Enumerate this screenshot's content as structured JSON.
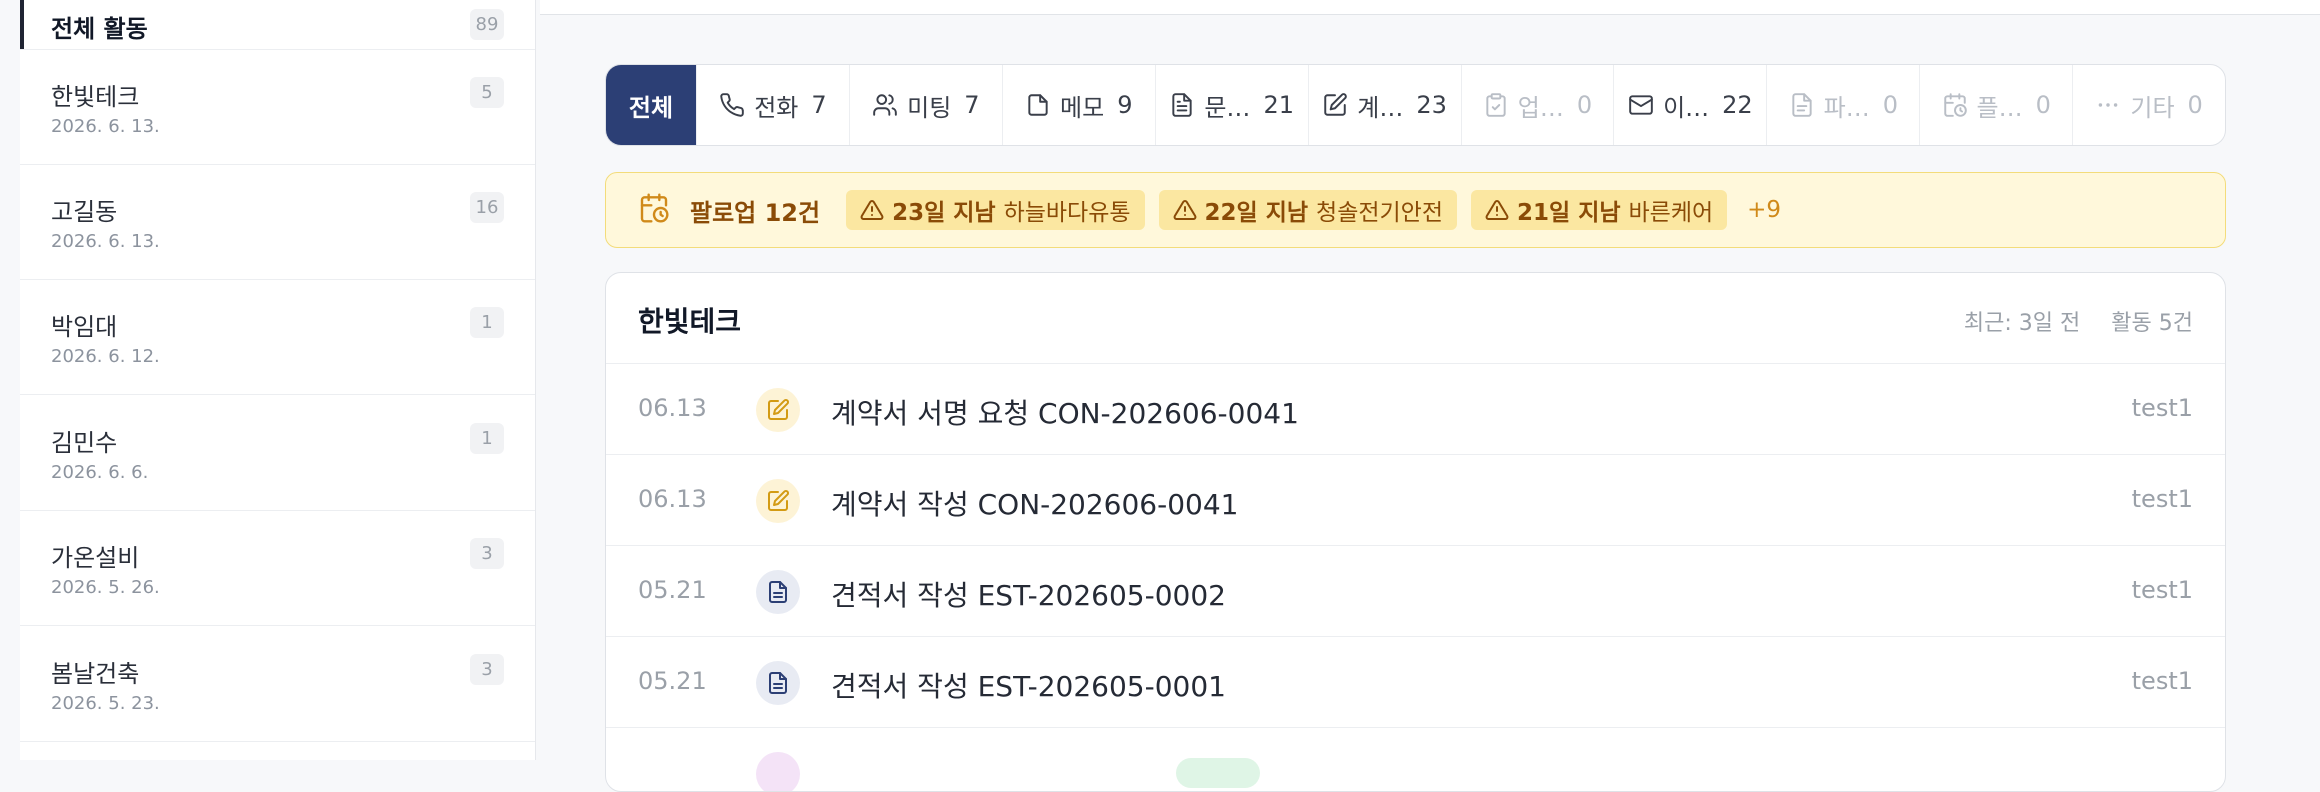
{
  "sidebar": {
    "all": {
      "label": "전체 활동",
      "count": "89"
    },
    "items": [
      {
        "name": "한빛테크",
        "date": "2026. 6. 13.",
        "count": "5"
      },
      {
        "name": "고길동",
        "date": "2026. 6. 13.",
        "count": "16"
      },
      {
        "name": "박임대",
        "date": "2026. 6. 12.",
        "count": "1"
      },
      {
        "name": "김민수",
        "date": "2026. 6. 6.",
        "count": "1"
      },
      {
        "name": "가온설비",
        "date": "2026. 5. 26.",
        "count": "3"
      },
      {
        "name": "봄날건축",
        "date": "2026. 5. 23.",
        "count": "3"
      }
    ]
  },
  "tabs": [
    {
      "label": "전체",
      "count": "",
      "icon": "none"
    },
    {
      "label": "전화",
      "count": "7",
      "icon": "phone-icon"
    },
    {
      "label": "미팅",
      "count": "7",
      "icon": "users-icon"
    },
    {
      "label": "메모",
      "count": "9",
      "icon": "note-icon"
    },
    {
      "label": "문…",
      "count": "21",
      "icon": "document-icon"
    },
    {
      "label": "계…",
      "count": "23",
      "icon": "contract-icon"
    },
    {
      "label": "업…",
      "count": "0",
      "icon": "clipboard-icon"
    },
    {
      "label": "이…",
      "count": "22",
      "icon": "mail-icon"
    },
    {
      "label": "파…",
      "count": "0",
      "icon": "file-icon"
    },
    {
      "label": "플…",
      "count": "0",
      "icon": "calendar-clock-icon"
    },
    {
      "label": "기타",
      "count": "0",
      "icon": "more-icon"
    }
  ],
  "followup": {
    "title": "팔로업 12건",
    "chips": [
      {
        "days": "23일 지남",
        "company": "하늘바다유통"
      },
      {
        "days": "22일 지남",
        "company": "청솔전기안전"
      },
      {
        "days": "21일 지남",
        "company": "바른케어"
      }
    ],
    "more": "+9"
  },
  "card": {
    "title": "한빛테크",
    "recent": "최근: 3일 전",
    "count": "활동 5건",
    "rows": [
      {
        "date": "06.13",
        "type": "contract",
        "text": "계약서 서명 요청 CON-202606-0041",
        "user": "test1"
      },
      {
        "date": "06.13",
        "type": "contract",
        "text": "계약서 작성 CON-202606-0041",
        "user": "test1"
      },
      {
        "date": "05.21",
        "type": "quote",
        "text": "견적서 작성 EST-202605-0002",
        "user": "test1"
      },
      {
        "date": "05.21",
        "type": "quote",
        "text": "견적서 작성 EST-202605-0001",
        "user": "test1"
      }
    ]
  },
  "colors": {
    "tab_active_bg": "#2c3f75",
    "followup_bg": "#fff8db",
    "followup_text": "#8a4b07",
    "contract_icon": "#d39b14",
    "quote_icon": "#2c3f75"
  }
}
